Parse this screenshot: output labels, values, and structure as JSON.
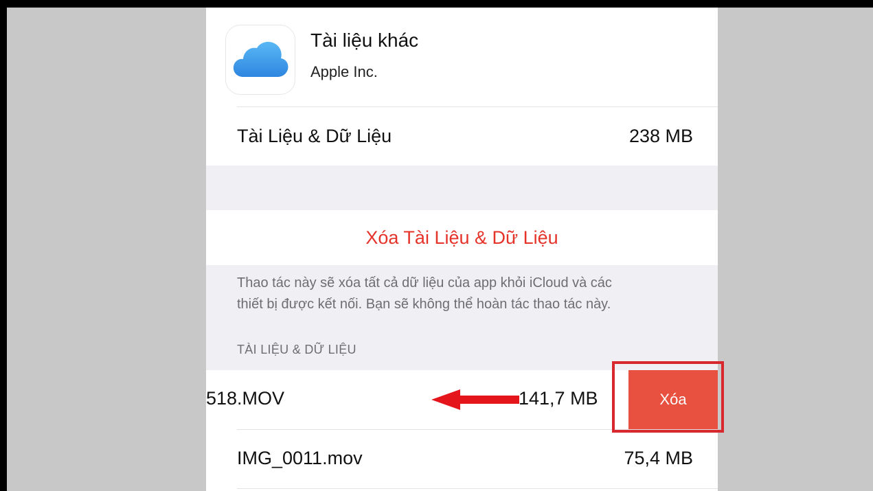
{
  "app": {
    "name": "Tài liệu khác",
    "developer": "Apple Inc.",
    "icon": "icloud-icon"
  },
  "storage": {
    "label": "Tài Liệu & Dữ Liệu",
    "value": "238 MB"
  },
  "delete_all": {
    "label": "Xóa Tài Liệu & Dữ Liệu",
    "color": "#e5332a"
  },
  "footnote": {
    "line1": "Thao tác này sẽ xóa tất cả dữ liệu của app khỏi iCloud và các",
    "line2": "thiết bị được kết nối. Bạn sẽ không thể hoàn tác thao tác này."
  },
  "section_header": "TÀI LIỆU & DỮ LIỆU",
  "files": [
    {
      "name": "518.MOV",
      "size": "141,7 MB",
      "swiped": true,
      "action_label": "Xóa"
    },
    {
      "name": "IMG_0011.mov",
      "size": "75,4 MB",
      "swiped": false
    }
  ],
  "annotation": {
    "arrow": "left-arrow-icon",
    "color": "#d9272e"
  }
}
